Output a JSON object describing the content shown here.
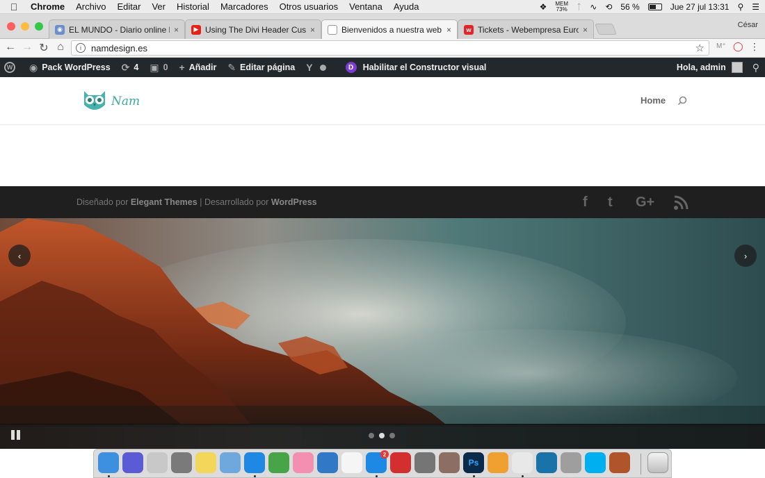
{
  "menubar": {
    "app": "Chrome",
    "items": [
      "Archivo",
      "Editar",
      "Ver",
      "Historial",
      "Marcadores",
      "Otros usuarios",
      "Ventana",
      "Ayuda"
    ],
    "mem_label": "MEM",
    "mem_value": "73%",
    "battery": "56 %",
    "battery_level": 0.56,
    "datetime": "Jue 27 jul  13:31"
  },
  "browser": {
    "profile": "César",
    "tabs": [
      {
        "title": "EL MUNDO - Diario online líder",
        "close": "×",
        "favicon": "globe-icon"
      },
      {
        "title": "Using The Divi Header Custom",
        "close": "×",
        "favicon": "youtube-icon"
      },
      {
        "title": "Bienvenidos a nuestra web - P",
        "close": "×",
        "favicon": "page-icon"
      },
      {
        "title": "Tickets - Webempresa Europa",
        "close": "×",
        "favicon": "webempresa-icon"
      }
    ],
    "url": "namdesign.es"
  },
  "wpadmin": {
    "site": "Pack WordPress",
    "updates": "4",
    "comments": "0",
    "add": "Añadir",
    "edit": "Editar página",
    "builder": "Habilitar el Constructor visual",
    "greeting": "Hola, admin"
  },
  "site": {
    "logo_text": "Nam",
    "nav": [
      "Home"
    ]
  },
  "footer": {
    "designed_by": "Diseñado por",
    "designer": "Elegant Themes",
    "separator": "|",
    "powered_by": "Desarrollado por",
    "platform": "WordPress",
    "social": [
      "facebook-icon",
      "twitter-icon",
      "google-plus-icon",
      "rss-icon"
    ],
    "social_glyphs": [
      "f",
      "t",
      "G+",
      "rss"
    ]
  },
  "slider": {
    "prev": "‹",
    "next": "›",
    "slide_count": 3,
    "active_slide": 2
  },
  "dock": {
    "apps": [
      "Finder",
      "Siri",
      "Launchpad",
      "Rocket",
      "Notes",
      "Preview",
      "Safari",
      "Numbers",
      "Photos",
      "Keynote",
      "TextEdit",
      "App Store",
      "Wunderlist",
      "System Preferences",
      "Sketchbook",
      "Photoshop",
      "Pages",
      "Chrome",
      "QuickTime",
      "Image Capture",
      "Skype",
      "Transmit"
    ],
    "app_store_badge": "2",
    "trash": "Trash"
  }
}
